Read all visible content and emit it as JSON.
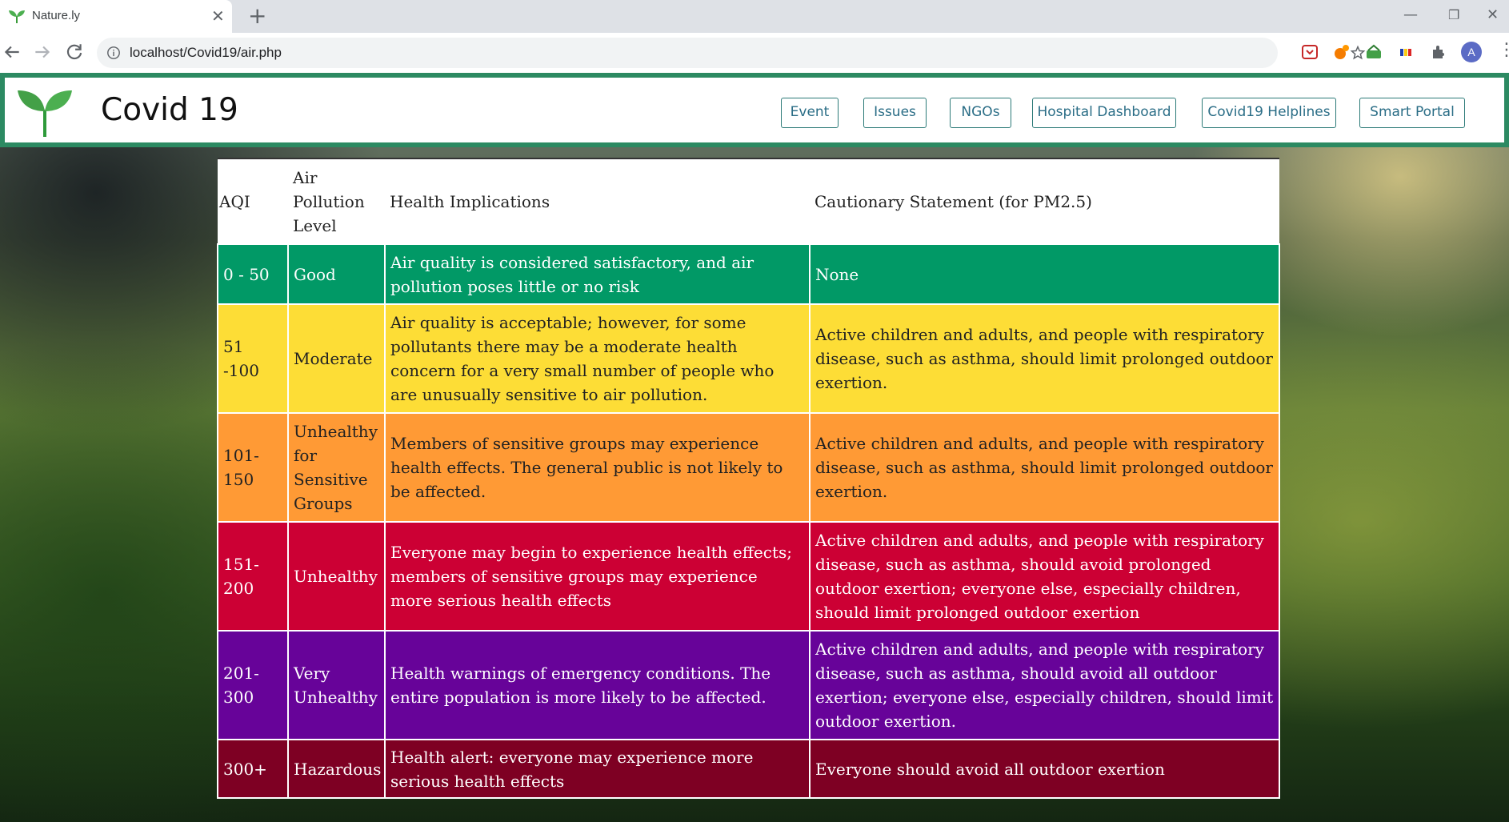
{
  "browser": {
    "tab_title": "Nature.ly",
    "tab_close": "✕",
    "new_tab": "+",
    "url": "localhost/Covid19/air.php",
    "avatar_letter": "A",
    "window_min": "—",
    "window_max": "❐",
    "window_close": "✕",
    "menu": "⋮"
  },
  "header": {
    "site_title": "Covid 19",
    "nav": [
      "Event",
      "Issues",
      "NGOs",
      "Hospital Dashboard",
      "Covid19 Helplines",
      "Smart Portal"
    ],
    "accent_color": "#2c8a62"
  },
  "aqi_table": {
    "headers": [
      "AQI",
      "Air Pollution Level",
      "Health Implications",
      "Cautionary Statement (for PM2.5)"
    ],
    "rows": [
      {
        "aqi": "0 - 50",
        "level": "Good",
        "health": "Air quality is considered satisfactory, and air pollution poses little or no risk",
        "caution": "None",
        "color": "#019966"
      },
      {
        "aqi": "51 -100",
        "level": "Moderate",
        "health": "Air quality is acceptable; however, for some pollutants there may be a moderate health concern for a very small number of people who are unusually sensitive to air pollution.",
        "caution": "Active children and adults, and people with respiratory disease, such as asthma, should limit prolonged outdoor exertion.",
        "color": "#fddd36"
      },
      {
        "aqi": "101-150",
        "level": "Unhealthy for Sensitive Groups",
        "health": "Members of sensitive groups may experience health effects. The general public is not likely to be affected.",
        "caution": "Active children and adults, and people with respiratory disease, such as asthma, should limit prolonged outdoor exertion.",
        "color": "#ff9a35"
      },
      {
        "aqi": "151-200",
        "level": "Unhealthy",
        "health": "Everyone may begin to experience health effects; members of sensitive groups may experience more serious health effects",
        "caution": "Active children and adults, and people with respiratory disease, such as asthma, should avoid prolonged outdoor exertion; everyone else, especially children, should limit prolonged outdoor exertion",
        "color": "#cc0034"
      },
      {
        "aqi": "201-300",
        "level": "Very Unhealthy",
        "health": "Health warnings of emergency conditions. The entire population is more likely to be affected.",
        "caution": "Active children and adults, and people with respiratory disease, such as asthma, should avoid all outdoor exertion; everyone else, especially children, should limit outdoor exertion.",
        "color": "#670399"
      },
      {
        "aqi": "300+",
        "level": "Hazardous",
        "health": "Health alert: everyone may experience more serious health effects",
        "caution": "Everyone should avoid all outdoor exertion",
        "color": "#7e0023"
      }
    ]
  }
}
